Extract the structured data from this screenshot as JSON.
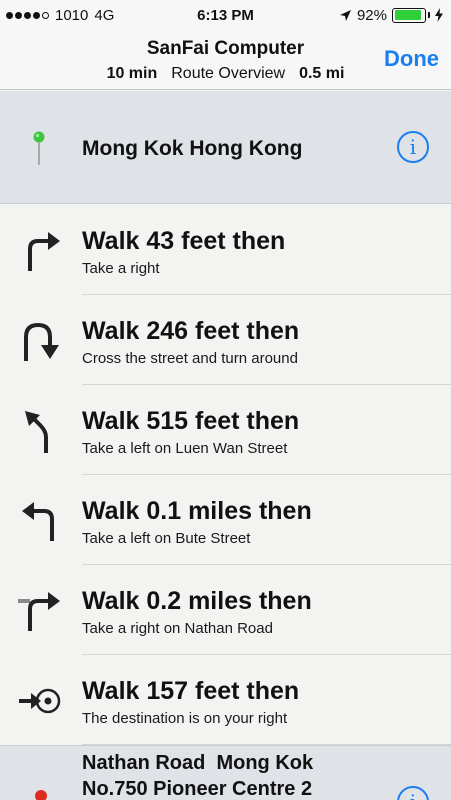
{
  "status_bar": {
    "carrier": "1010",
    "network": "4G",
    "time": "6:13 PM",
    "battery": "92%",
    "battery_level": 0.92,
    "signal_bars_filled": 4,
    "signal_bars_total": 5,
    "icons": [
      "signal-dots",
      "location-arrow-icon",
      "battery-icon",
      "charging-bolt-icon"
    ]
  },
  "nav": {
    "title": "SanFai Computer",
    "duration": "10 min",
    "overview_label": "Route Overview",
    "distance": "0.5 mi",
    "done_label": "Done"
  },
  "start": {
    "label": "Mong Kok Hong Kong",
    "pin_color": "#3cc63c",
    "info_icon": "info-icon"
  },
  "steps": [
    {
      "title": "Walk 43 feet then",
      "subtitle": "Take a right",
      "icon": "turn-right-icon"
    },
    {
      "title": "Walk 246 feet then",
      "subtitle": "Cross the street and turn around",
      "icon": "u-turn-icon"
    },
    {
      "title": "Walk 515 feet then",
      "subtitle": "Take a left on Luen Wan Street",
      "icon": "slight-left-icon"
    },
    {
      "title": "Walk 0.1 miles then",
      "subtitle": "Take a left on Bute Street",
      "icon": "turn-left-icon"
    },
    {
      "title": "Walk 0.2 miles then",
      "subtitle": "Take a right on Nathan Road",
      "icon": "turn-right-at-junction-icon"
    },
    {
      "title": "Walk 157 feet then",
      "subtitle": "The destination is on your right",
      "icon": "arrive-destination-icon"
    }
  ],
  "end": {
    "line1": "Nathan Road  Mong Kok",
    "line2": "No.750 Pioneer Centre 2",
    "pin_color": "#e02a1f"
  },
  "colors": {
    "accent": "#1b7ff0",
    "battery_green": "#2fcf3a",
    "location_row_bg": "#dfe2e6"
  }
}
